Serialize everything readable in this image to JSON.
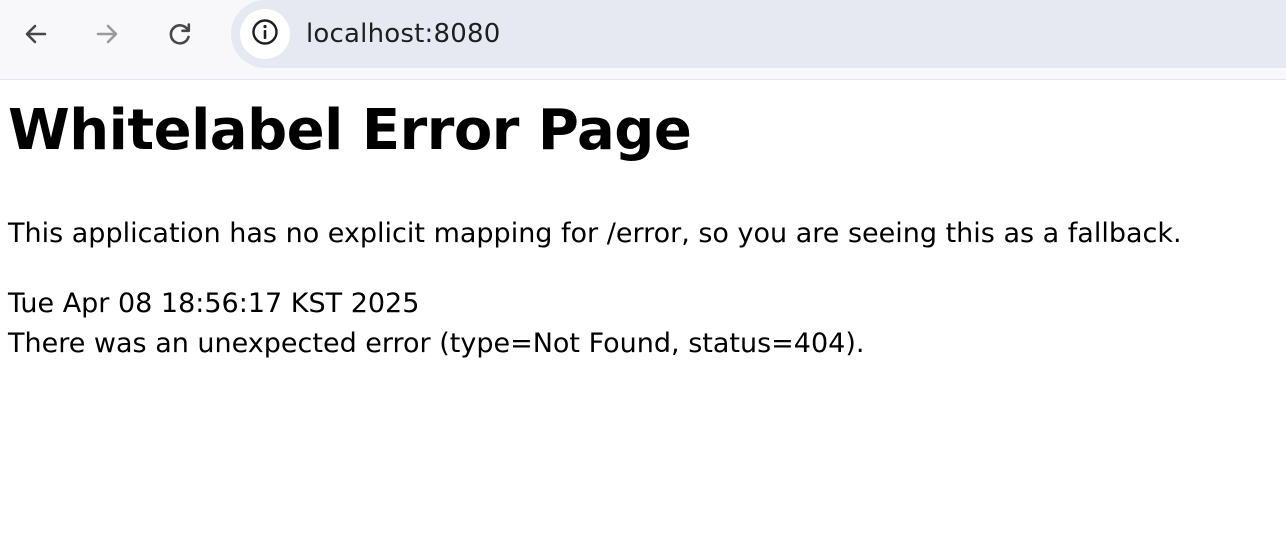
{
  "browser": {
    "url": "localhost:8080",
    "icons": {
      "back": "arrow-left-icon",
      "forward": "arrow-right-icon",
      "reload": "reload-icon",
      "site_info": "info-circle-icon"
    },
    "colors": {
      "toolbar_bg": "#f8f8fb",
      "omnibox_bg": "#e6e9f2",
      "icon_active": "#474747",
      "icon_disabled": "#9a9a9a"
    }
  },
  "page": {
    "title": "Whitelabel Error Page",
    "explanation": "This application has no explicit mapping for /error, so you are seeing this as a fallback.",
    "timestamp": "Tue Apr 08 18:56:17 KST 2025",
    "error_message": "There was an unexpected error (type=Not Found, status=404)."
  }
}
